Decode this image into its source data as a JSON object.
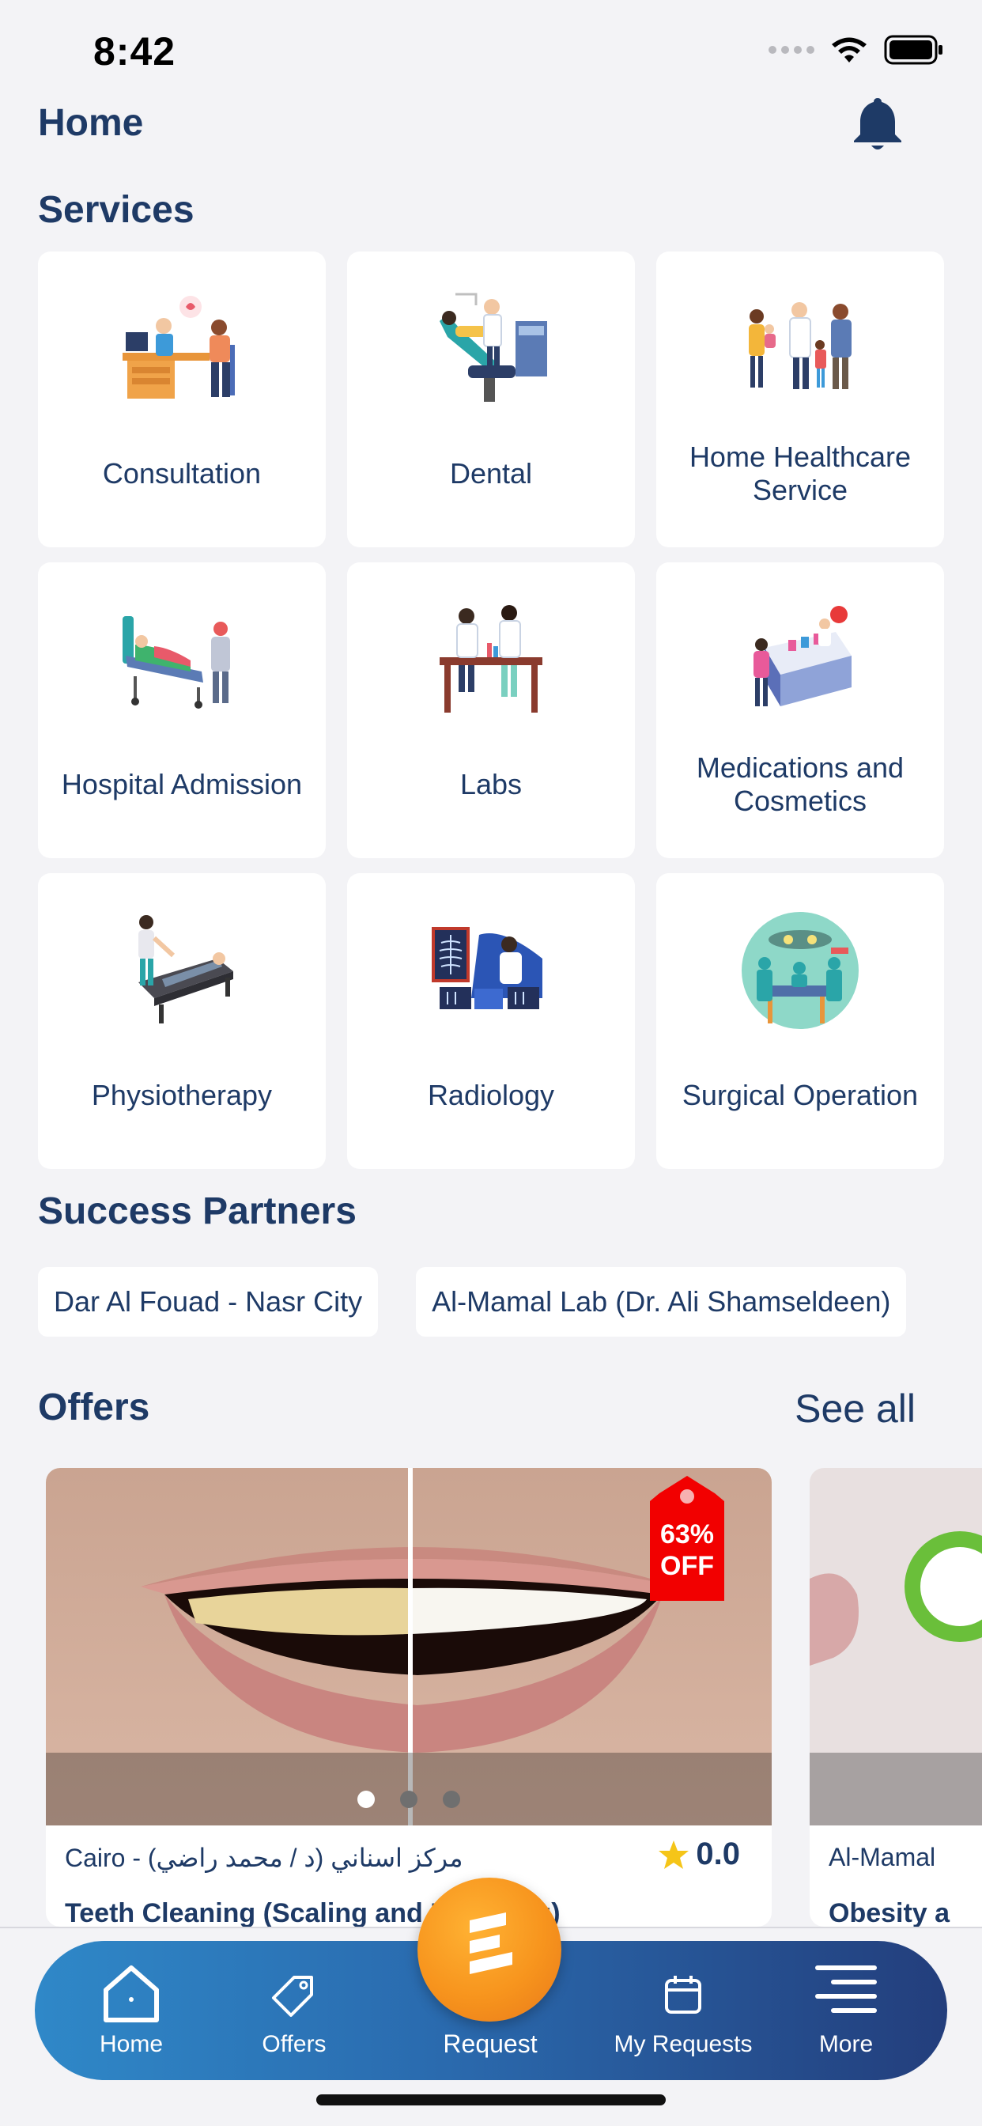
{
  "status_bar": {
    "time": "8:42"
  },
  "header": {
    "title": "Home"
  },
  "services": {
    "title": "Services",
    "items": [
      {
        "label": "Consultation",
        "icon": "consultation-illustration"
      },
      {
        "label": "Dental",
        "icon": "dental-illustration"
      },
      {
        "label": "Home Healthcare Service",
        "icon": "home-healthcare-illustration"
      },
      {
        "label": "Hospital Admission",
        "icon": "hospital-bed-illustration"
      },
      {
        "label": "Labs",
        "icon": "labs-illustration"
      },
      {
        "label": "Medications and Cosmetics",
        "icon": "pharmacy-illustration"
      },
      {
        "label": "Physiotherapy",
        "icon": "physiotherapy-illustration"
      },
      {
        "label": "Radiology",
        "icon": "radiology-illustration"
      },
      {
        "label": "Surgical Operation",
        "icon": "surgery-illustration"
      }
    ]
  },
  "partners": {
    "title": "Success Partners",
    "items": [
      "Dar Al Fouad - Nasr City",
      "Al-Mamal Lab (Dr. Ali Shamseldeen)"
    ]
  },
  "offers": {
    "title": "Offers",
    "see_all": "See all",
    "items": [
      {
        "discount_percent": "63%",
        "discount_suffix": "OFF",
        "location": "Cairo - مركز اسناني (د / محمد راضي)",
        "rating": "0.0",
        "title": "Teeth Cleaning (Scaling and Polishing)"
      },
      {
        "location": "Al-Mamal",
        "title": "Obesity a"
      }
    ]
  },
  "tabbar": {
    "home": "Home",
    "offers": "Offers",
    "request": "Request",
    "my_requests": "My Requests",
    "more": "More"
  },
  "colors": {
    "primary": "#1e3a66",
    "accent_orange": "#f7941d",
    "discount_red": "#f20000",
    "star": "#f5c518",
    "background": "#f3f3f6"
  }
}
